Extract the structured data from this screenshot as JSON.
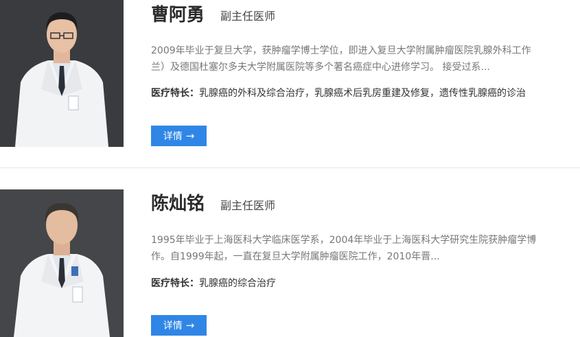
{
  "doctors": [
    {
      "name": "曹阿勇",
      "title": "副主任医师",
      "bio_line1": "2009年毕业于复旦大学，获肿瘤学博士学位，即进入复旦大学附属肿瘤医院乳腺外科工作",
      "bio_line2": "兰）及德国杜塞尔多夫大学附属医院等多个著名癌症中心进修学习。 接受过系...",
      "specialty_label": "医疗特长：",
      "specialty": "乳腺癌的外科及综合治疗，乳腺癌术后乳房重建及修复，遗传性乳腺癌的诊治",
      "detail_label": "详情",
      "detail_icon": "arrow-right-icon"
    },
    {
      "name": "陈灿铭",
      "title": "副主任医师",
      "bio_line1": "1995年毕业于上海医科大学临床医学系，2004年毕业于上海医科大学研究生院获肿瘤学博",
      "bio_line2": "作。自1999年起，一直在复旦大学附属肿瘤医院工作，2010年晋...",
      "specialty_label": "医疗特长：",
      "specialty": "乳腺癌的综合治疗",
      "detail_label": "详情",
      "detail_icon": "arrow-right-icon"
    }
  ],
  "colors": {
    "button": "#2f86e6",
    "photo_background": "#3c3d40",
    "divider": "#e6e6e6"
  }
}
